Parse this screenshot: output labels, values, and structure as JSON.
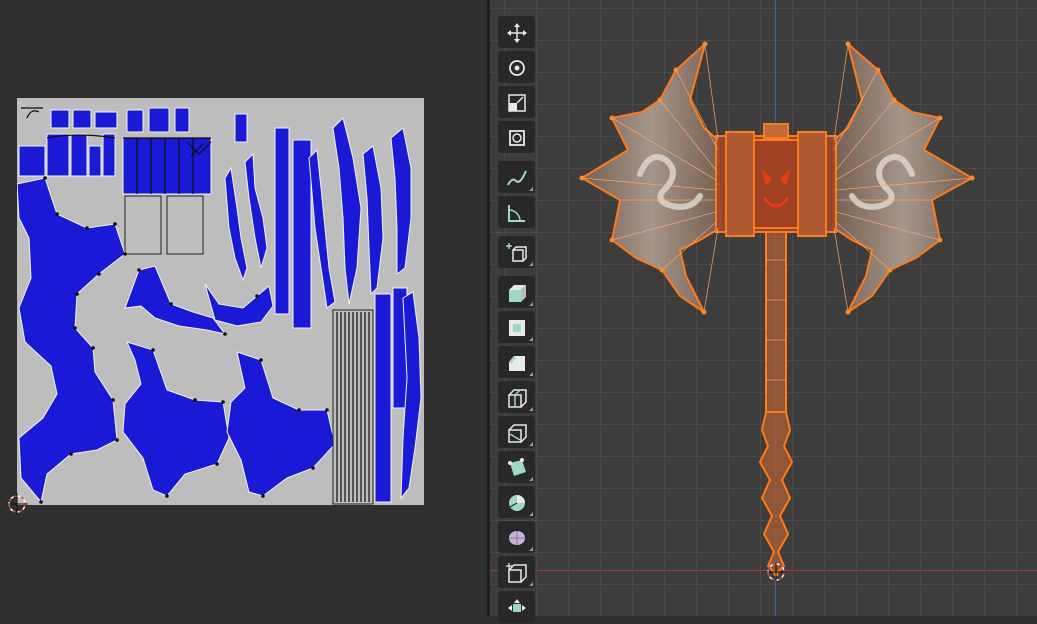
{
  "uv_editor": {
    "canvas_color": "#bdbdbd",
    "island_color": "#1a1ad6"
  },
  "viewport": {
    "mesh_color": "#ff7a1a",
    "axis_x_color": "#9c3b3b",
    "axis_z_color": "#3e5fa8"
  },
  "toolbar": {
    "tools": [
      {
        "icon": "move-icon"
      },
      {
        "icon": "rotate-icon"
      },
      {
        "icon": "scale-icon"
      },
      {
        "icon": "transform-icon"
      },
      {
        "icon": "annotate-icon"
      },
      {
        "icon": "measure-icon"
      },
      {
        "icon": "add-cube-icon"
      },
      {
        "icon": "extrude-region-icon"
      },
      {
        "icon": "inset-faces-icon"
      },
      {
        "icon": "bevel-icon"
      },
      {
        "icon": "loop-cut-icon"
      },
      {
        "icon": "knife-icon"
      },
      {
        "icon": "poly-build-icon"
      },
      {
        "icon": "spin-icon"
      },
      {
        "icon": "smooth-icon"
      },
      {
        "icon": "shear-icon"
      },
      {
        "icon": "shrink-fatten-icon"
      }
    ]
  }
}
